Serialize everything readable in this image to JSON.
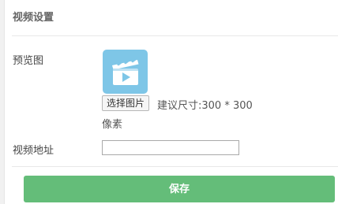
{
  "panel": {
    "title": "视频设置"
  },
  "form": {
    "preview_label": "预览图",
    "preview_icon": "video-clapperboard-icon",
    "choose_image_button": "选择图片",
    "size_hint": "建议尺寸:300 * 300",
    "size_hint_unit": "像素",
    "video_url_label": "视频地址",
    "video_url_value": "",
    "video_url_placeholder": ""
  },
  "actions": {
    "save_label": "保存"
  },
  "colors": {
    "thumbnail_bg": "#7ec6e7",
    "save_button": "#64bd79"
  }
}
